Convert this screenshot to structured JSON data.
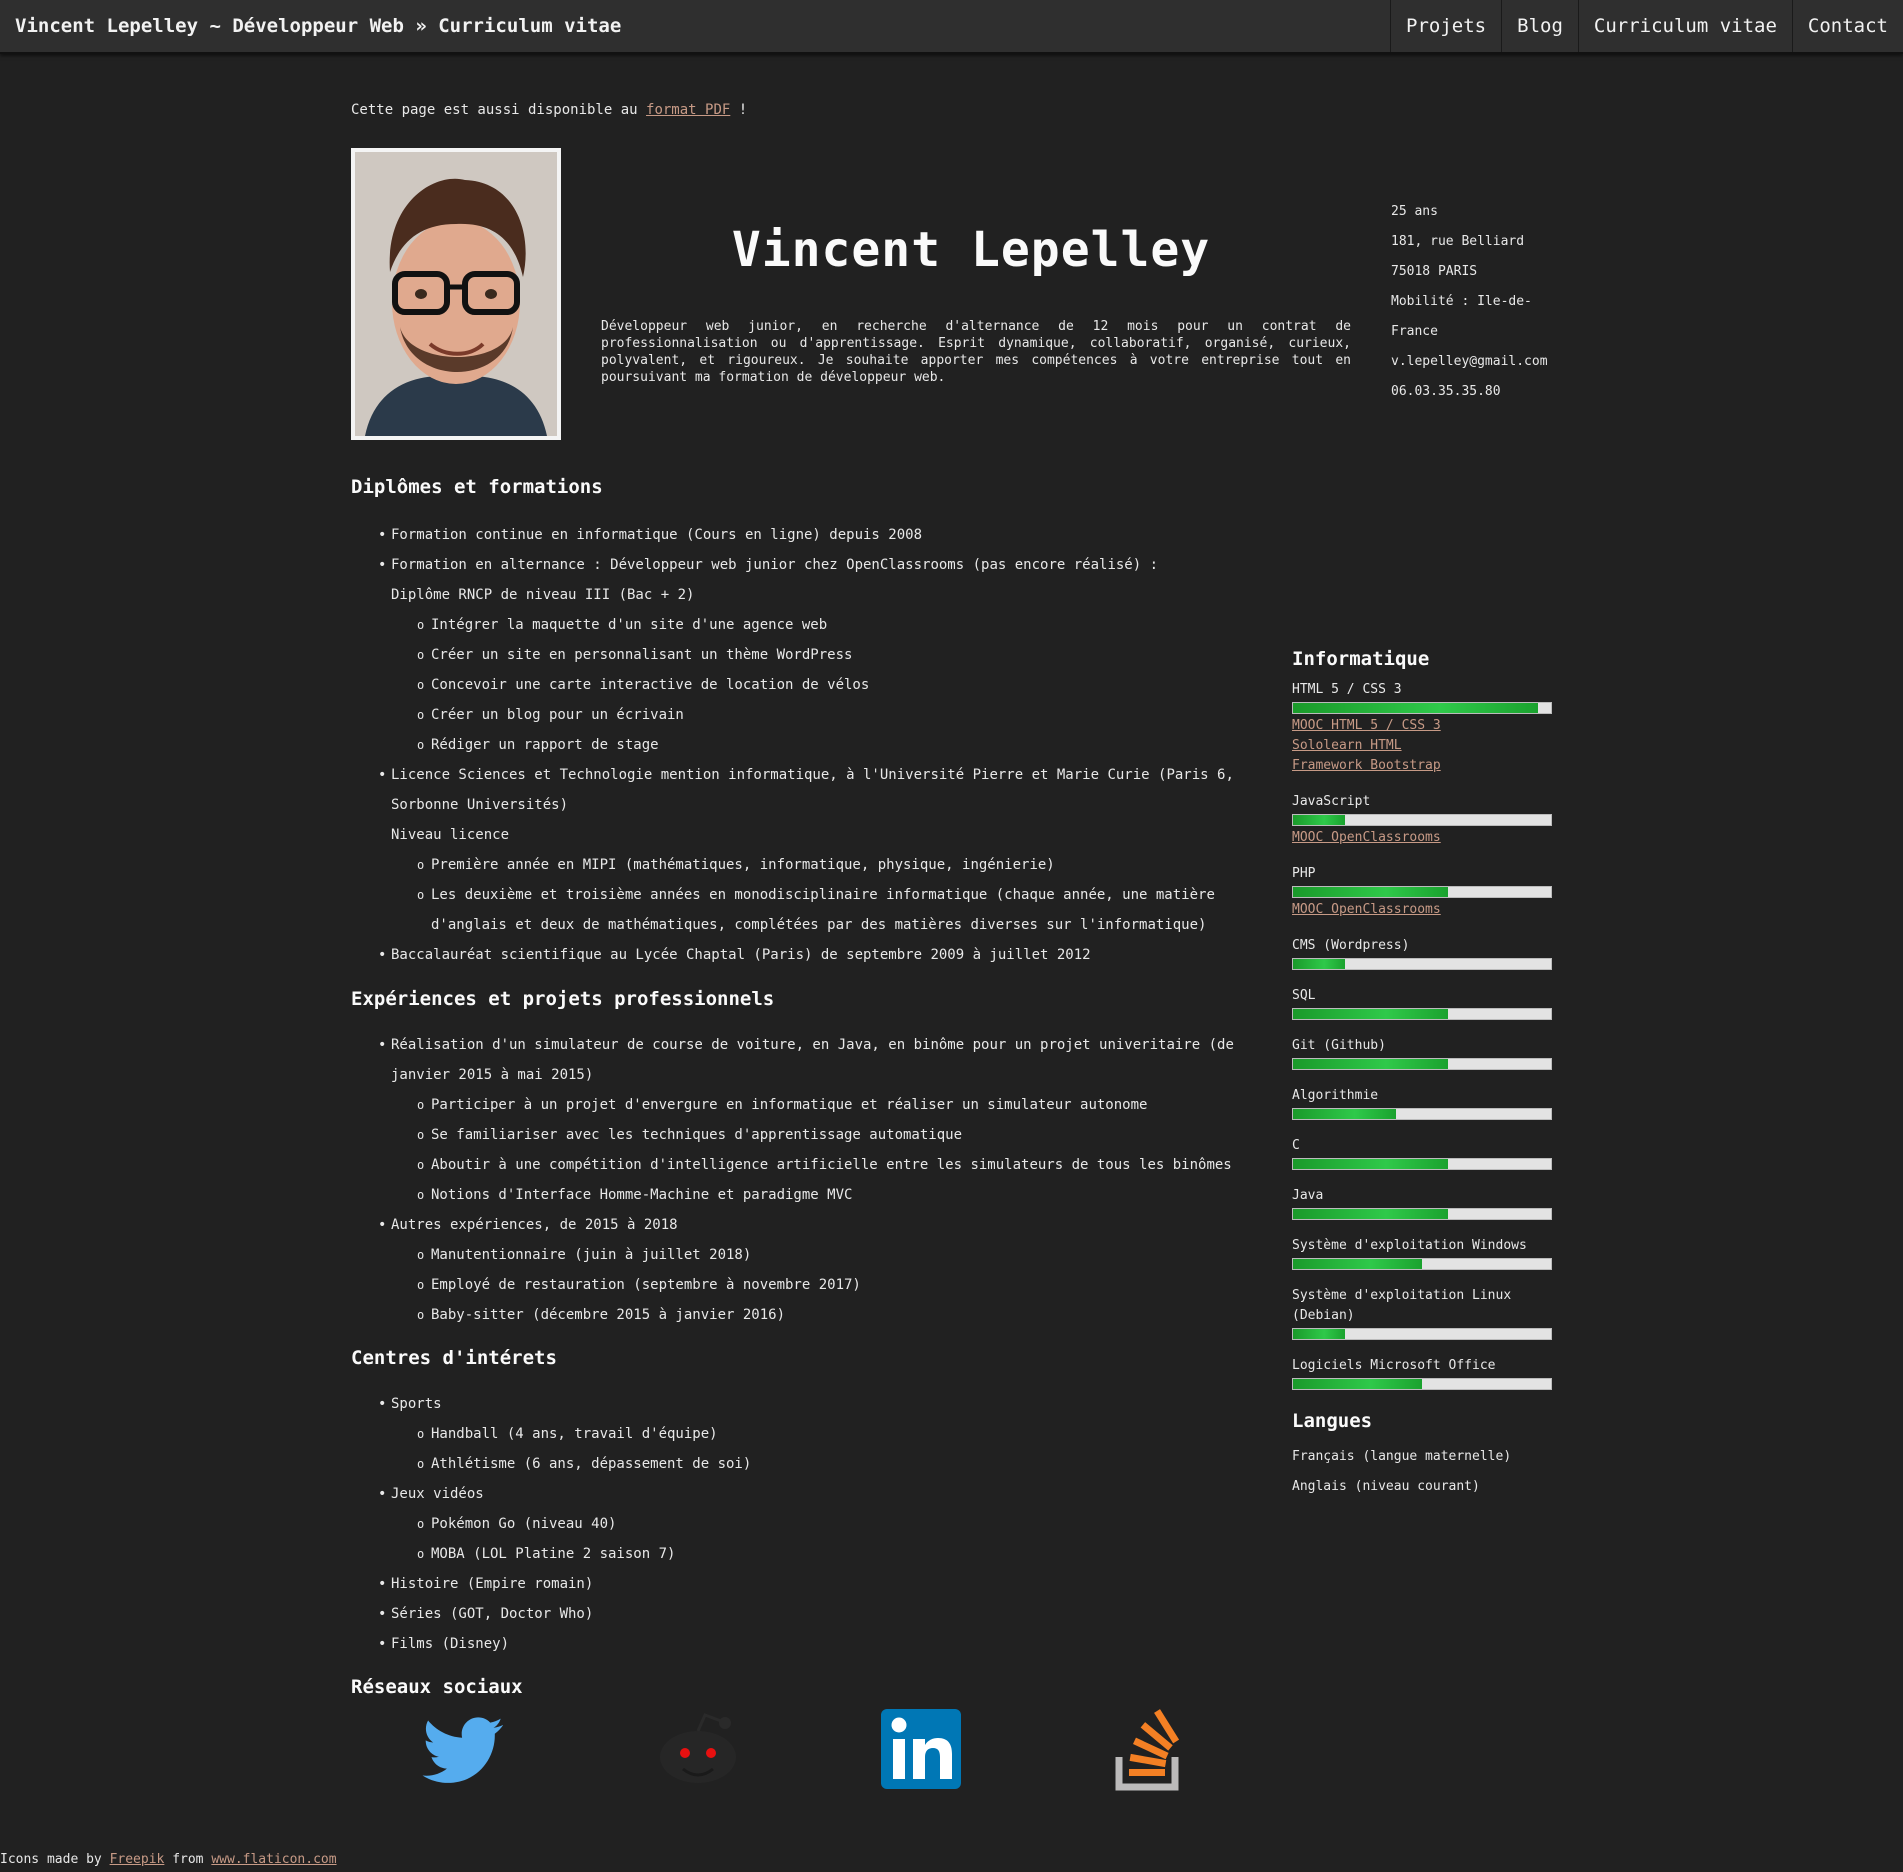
{
  "header": {
    "brand": "Vincent Lepelley ~ Développeur Web » Curriculum vitae",
    "nav": [
      "Projets",
      "Blog",
      "Curriculum vitae",
      "Contact"
    ]
  },
  "pdf_note": {
    "before": "Cette page est aussi disponible au",
    "link": "format PDF",
    "after": "!"
  },
  "profile": {
    "name": "Vincent Lepelley",
    "intro": "Développeur web junior, en recherche d'alternance de 12 mois pour un contrat de professionnalisation ou d'apprentissage. Esprit dynamique, collaboratif, organisé, curieux, polyvalent, et rigoureux. Je souhaite apporter mes compétences à votre entreprise tout en poursuivant ma formation de développeur web.",
    "contact": [
      "25 ans",
      "181, rue Belliard",
      "75018 PARIS",
      "Mobilité : Ile-de-France",
      "v.lepelley@gmail.com",
      "06.03.35.35.80"
    ]
  },
  "diplomas": {
    "title": "Diplômes et formations",
    "items": [
      {
        "text": "Formation continue en informatique (Cours en ligne) depuis 2008"
      },
      {
        "text": "Formation en alternance : Développeur web junior chez OpenClassrooms (pas encore réalisé) :",
        "label": "Diplôme RNCP de niveau III (Bac + 2)",
        "sub": [
          "Intégrer la maquette d'un site d'une agence web",
          "Créer un site en personnalisant un thème WordPress",
          "Concevoir une carte interactive de location de vélos",
          "Créer un blog pour un écrivain",
          "Rédiger un rapport de stage"
        ]
      },
      {
        "text": "Licence Sciences et Technologie mention informatique, à l'Université Pierre et Marie Curie (Paris 6, Sorbonne Universités)",
        "label": "Niveau licence",
        "sub": [
          "Première année en MIPI (mathématiques, informatique, physique, ingénierie)",
          "Les deuxième et troisième années en monodisciplinaire informatique (chaque année, une matière d'anglais et deux de mathématiques, complétées par des matières diverses sur l'informatique)"
        ]
      },
      {
        "text": "Baccalauréat scientifique au Lycée Chaptal (Paris) de septembre 2009 à juillet 2012"
      }
    ]
  },
  "experiences": {
    "title": "Expériences et projets professionnels",
    "items": [
      {
        "text": "Réalisation d'un simulateur de course de voiture, en Java, en binôme pour un projet univeritaire (de janvier 2015 à mai 2015)",
        "sub": [
          "Participer à un projet d'envergure en informatique et réaliser un simulateur autonome",
          "Se familiariser avec les techniques d'apprentissage automatique",
          "Aboutir à une compétition d'intelligence artificielle entre les simulateurs de tous les binômes",
          "Notions d'Interface Homme-Machine et paradigme MVC"
        ]
      },
      {
        "text": "Autres expériences, de 2015 à 2018",
        "sub": [
          "Manutentionnaire (juin à juillet 2018)",
          "Employé de restauration (septembre à novembre 2017)",
          "Baby-sitter (décembre 2015 à janvier 2016)"
        ]
      }
    ]
  },
  "interests": {
    "title": "Centres d'intérets",
    "items": [
      {
        "text": "Sports",
        "sub": [
          "Handball (4 ans, travail d'équipe)",
          "Athlétisme (6 ans, dépassement de soi)"
        ]
      },
      {
        "text": "Jeux vidéos",
        "sub": [
          "Pokémon Go (niveau 40)",
          "MOBA (LOL Platine 2 saison 7)"
        ]
      },
      {
        "text": "Histoire (Empire romain)"
      },
      {
        "text": "Séries (GOT, Doctor Who)"
      },
      {
        "text": "Films (Disney)"
      }
    ]
  },
  "skills": {
    "title": "Informatique",
    "items": [
      {
        "name": "HTML 5 / CSS 3",
        "level": 0.95,
        "links": [
          "MOOC HTML 5 / CSS 3",
          "Sololearn HTML",
          "Framework Bootstrap"
        ]
      },
      {
        "name": "JavaScript",
        "level": 0.2,
        "links": [
          "MOOC OpenClassrooms"
        ]
      },
      {
        "name": "PHP",
        "level": 0.6,
        "links": [
          "MOOC OpenClassrooms"
        ]
      },
      {
        "name": "CMS (Wordpress)",
        "level": 0.2,
        "links": []
      },
      {
        "name": "SQL",
        "level": 0.6,
        "links": []
      },
      {
        "name": "Git (Github)",
        "level": 0.6,
        "links": []
      },
      {
        "name": "Algorithmie",
        "level": 0.4,
        "links": []
      },
      {
        "name": "C",
        "level": 0.6,
        "links": []
      },
      {
        "name": "Java",
        "level": 0.6,
        "links": []
      },
      {
        "name": "Système d'exploitation Windows",
        "level": 0.5,
        "links": []
      },
      {
        "name": "Système d'exploitation Linux (Debian)",
        "level": 0.2,
        "links": []
      },
      {
        "name": "Logiciels Microsoft Office",
        "level": 0.5,
        "links": []
      }
    ]
  },
  "languages": {
    "title": "Langues",
    "items": [
      "Français (langue maternelle)",
      "Anglais (niveau courant)"
    ]
  },
  "social": {
    "title": "Réseaux sociaux",
    "icons": [
      "twitter-icon",
      "reddit-icon",
      "linkedin-icon",
      "stackoverflow-icon"
    ],
    "linkedin_text": "in"
  },
  "footer": {
    "before": "Icons made by",
    "author": "Freepik",
    "middle": "from",
    "site": "www.flaticon.com"
  },
  "colors": {
    "background": "#212121",
    "header": "#2f2f2f",
    "link": "#c79a86",
    "bar": "#2fc94a",
    "twitter": "#55acee",
    "linkedin": "#0077b5",
    "stackoverflow": "#f48024"
  }
}
